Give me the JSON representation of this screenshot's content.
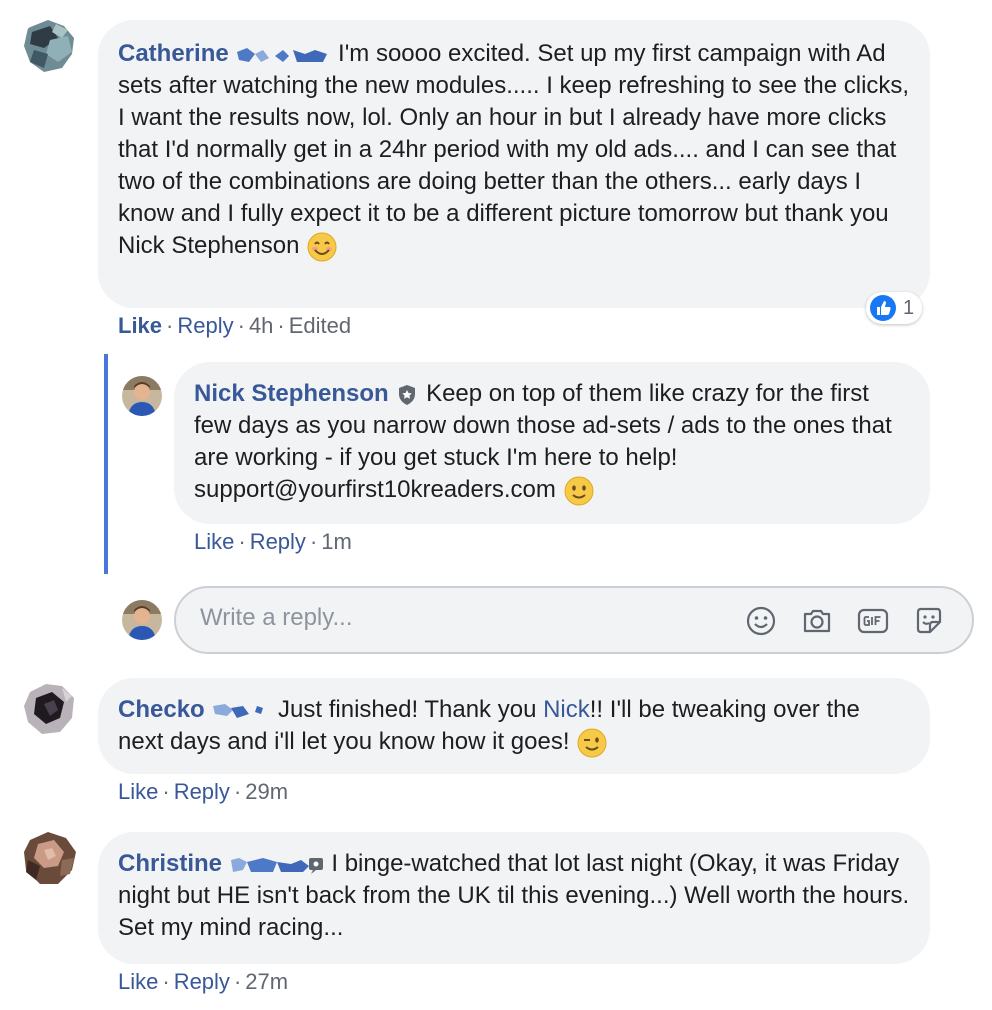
{
  "comments": [
    {
      "author": "Catherine",
      "text": "I'm soooo excited. Set up my first campaign with Ad sets after watching the new modules..... I keep refreshing to see the clicks, I want the results now, lol. Only an hour in but I already have more clicks that I'd normally get in a 24hr period with my old ads.... and I can see that two of the combinations are doing better than the others... early days I know and I fully expect it to be a different picture tomorrow but thank you Nick Stephenson",
      "emoji": "smiling-face-icon",
      "like_label": "Like",
      "reply_label": "Reply",
      "time": "4h",
      "edited": "Edited",
      "reaction_count": "1"
    },
    {
      "author": "Nick Stephenson",
      "text": "Keep on top of them like crazy for the first few days as you narrow down those ad-sets / ads to the ones that are working - if you get stuck I'm here to help! support@yourfirst10kreaders.com",
      "emoji": "slight-smile-icon",
      "like_label": "Like",
      "reply_label": "Reply",
      "time": "1m"
    },
    {
      "author": "Checko",
      "text_before": "Just finished! Thank you",
      "mention": "Nick",
      "text_after": "!! I'll be tweaking over the next days and i'll let you know how it goes!",
      "emoji": "wink-icon",
      "like_label": "Like",
      "reply_label": "Reply",
      "time": "29m"
    },
    {
      "author": "Christine",
      "text": "I binge-watched that lot last night (Okay, it was Friday night but HE isn't back from the UK til this evening...) Well worth the hours. Set my mind racing...",
      "like_label": "Like",
      "reply_label": "Reply",
      "time": "27m"
    }
  ],
  "reply_box": {
    "placeholder": "Write a reply...",
    "icons": [
      "emoji-icon",
      "camera-icon",
      "gif-icon",
      "sticker-icon"
    ]
  },
  "colors": {
    "author": "#385898",
    "bubble": "#f2f3f5",
    "thread_line": "#4a76d9",
    "reaction_blue": "#1877f2"
  }
}
